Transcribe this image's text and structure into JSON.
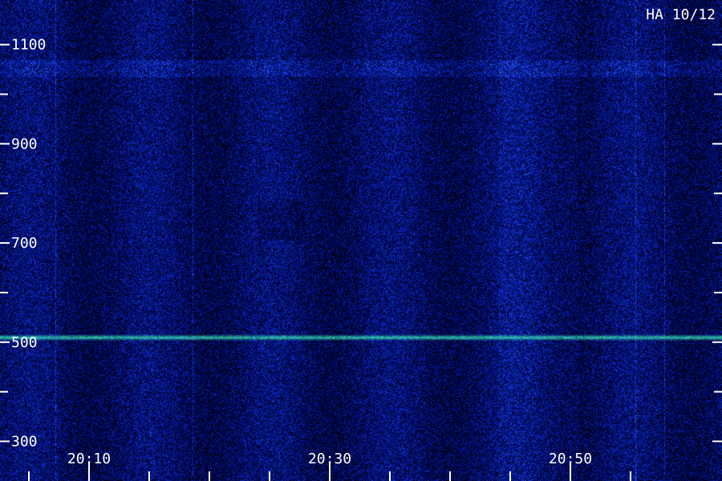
{
  "chart_data": {
    "type": "heatmap",
    "title": "",
    "corner_label": "HA 10/12",
    "xlabel": "",
    "ylabel": "",
    "y_tick_labels": [
      "1100",
      "900",
      "700",
      "500",
      "300"
    ],
    "y_major_values": [
      1100,
      900,
      700,
      500,
      300
    ],
    "y_minor_values": [
      1000,
      800,
      600,
      400
    ],
    "ylim": [
      220,
      1190
    ],
    "x_tick_labels": [
      "20:10",
      "20:30",
      "20:50"
    ],
    "x_major_minutes": [
      10,
      30,
      50
    ],
    "x_minor_minutes": [
      5,
      15,
      20,
      25,
      35,
      40,
      45,
      55
    ],
    "xlim_minutes": [
      2.6,
      62.6
    ],
    "grid": false,
    "legend": "none",
    "colormap": [
      "#000010",
      "#000a6e",
      "#1030d0",
      "#3a78ff",
      "#40ffc8"
    ],
    "bright_line_value": 510,
    "bright_line_color": "#40ffc8",
    "text_color": "#ffffff",
    "bright_bands": [
      [
        1035,
        1070
      ]
    ],
    "periodic_period_minutes": 10,
    "vertical_lines_minutes": [
      7.2,
      18.6,
      55.4,
      57.8
    ]
  }
}
